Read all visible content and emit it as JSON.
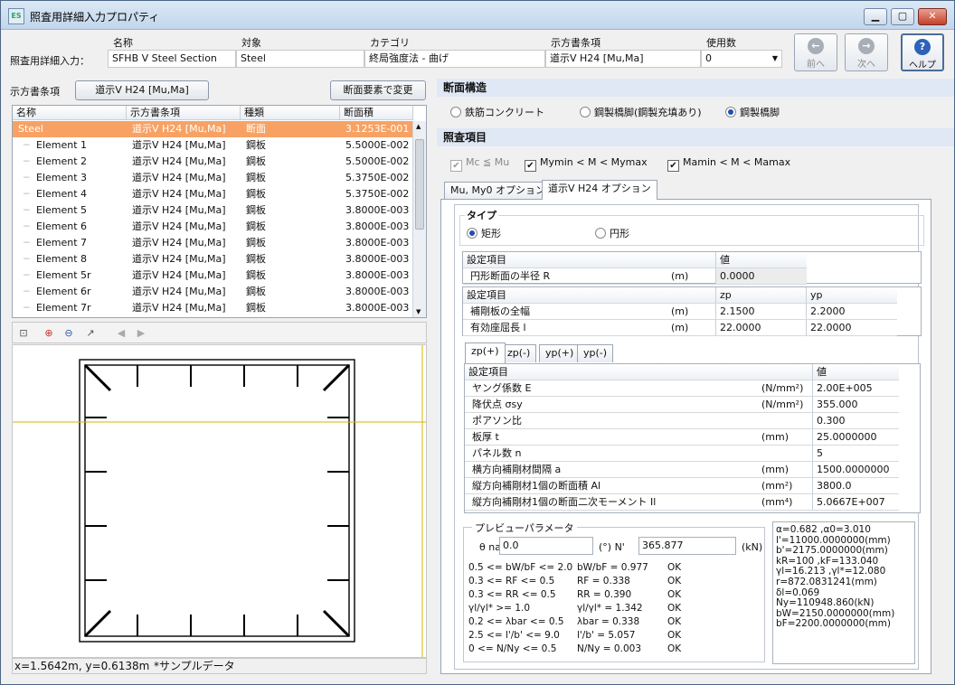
{
  "window": {
    "title": "照査用詳細入力プロパティ",
    "app_icon": "ES"
  },
  "header": {
    "row_label": "照査用詳細入力：",
    "cols": [
      "名称",
      "対象",
      "カテゴリ",
      "示方書条項",
      "使用数"
    ],
    "values": [
      "SFHB V Steel Section",
      "Steel",
      "終局強度法 - 曲げ",
      "道示V H24 [Mu,Ma]",
      "0"
    ]
  },
  "nav": {
    "prev": "前へ",
    "next": "次へ",
    "help": "ヘルプ"
  },
  "left": {
    "clause_label": "示方書条項",
    "clause_button": "道示V H24 [Mu,Ma]",
    "change_button": "断面要素で変更",
    "grid_headers": [
      "名称",
      "示方書条項",
      "種類",
      "断面積"
    ],
    "rows": [
      {
        "name": "Steel",
        "clause": "道示V H24 [Mu,Ma]",
        "kind": "断面",
        "area": "3.1253E-001"
      },
      {
        "name": "Element  1",
        "clause": "道示V H24 [Mu,Ma]",
        "kind": "鋼板",
        "area": "5.5000E-002"
      },
      {
        "name": "Element  2",
        "clause": "道示V H24 [Mu,Ma]",
        "kind": "鋼板",
        "area": "5.5000E-002"
      },
      {
        "name": "Element  3",
        "clause": "道示V H24 [Mu,Ma]",
        "kind": "鋼板",
        "area": "5.3750E-002"
      },
      {
        "name": "Element  4",
        "clause": "道示V H24 [Mu,Ma]",
        "kind": "鋼板",
        "area": "5.3750E-002"
      },
      {
        "name": "Element  5",
        "clause": "道示V H24 [Mu,Ma]",
        "kind": "鋼板",
        "area": "3.8000E-003"
      },
      {
        "name": "Element  6",
        "clause": "道示V H24 [Mu,Ma]",
        "kind": "鋼板",
        "area": "3.8000E-003"
      },
      {
        "name": "Element  7",
        "clause": "道示V H24 [Mu,Ma]",
        "kind": "鋼板",
        "area": "3.8000E-003"
      },
      {
        "name": "Element  8",
        "clause": "道示V H24 [Mu,Ma]",
        "kind": "鋼板",
        "area": "3.8000E-003"
      },
      {
        "name": "Element  5r",
        "clause": "道示V H24 [Mu,Ma]",
        "kind": "鋼板",
        "area": "3.8000E-003"
      },
      {
        "name": "Element  6r",
        "clause": "道示V H24 [Mu,Ma]",
        "kind": "鋼板",
        "area": "3.8000E-003"
      },
      {
        "name": "Element  7r",
        "clause": "道示V H24 [Mu,Ma]",
        "kind": "鋼板",
        "area": "3.8000E-003"
      }
    ],
    "status_coords": "x=1.5642m, y=0.6138m",
    "status_note": "*サンプルデータ"
  },
  "right": {
    "section_structure": "断面構造",
    "structure_options": [
      "鉄筋コンクリート",
      "鋼製橋脚(鋼製充填あり)",
      "鋼製橋脚"
    ],
    "structure_selected": 2,
    "check_items": "照査項目",
    "checks": [
      {
        "label": "Mc ≦ Mu",
        "checked": true,
        "disabled": true
      },
      {
        "label": "Mymin < M < Mymax",
        "checked": true,
        "disabled": false
      },
      {
        "label": "Mamin < M < Mamax",
        "checked": true,
        "disabled": false
      }
    ],
    "tabs": [
      "Mu, My0 オプション",
      "道示V H24 オプション"
    ],
    "type_label": "タイプ",
    "type_options": [
      "矩形",
      "円形"
    ],
    "type_selected": 0,
    "t1": {
      "h1": "設定項目",
      "h2": "値",
      "row": {
        "label": "円形断面の半径 R",
        "unit": "(m)",
        "value": "0.0000"
      }
    },
    "t2": {
      "h1": "設定項目",
      "h2": "zp",
      "h3": "yp",
      "rows": [
        {
          "label": "補剛板の全幅",
          "unit": "(m)",
          "zp": "2.1500",
          "yp": "2.2000"
        },
        {
          "label": "有効座屈長 l",
          "unit": "(m)",
          "zp": "22.0000",
          "yp": "22.0000"
        }
      ]
    },
    "subtabs": [
      "zp(+)",
      "zp(-)",
      "yp(+)",
      "yp(-)"
    ],
    "t3": {
      "h1": "設定項目",
      "h2": "値",
      "rows": [
        {
          "label": "ヤング係数 E",
          "unit": "(N/mm²)",
          "value": "2.00E+005"
        },
        {
          "label": "降伏点 σsy",
          "unit": "(N/mm²)",
          "value": "355.000"
        },
        {
          "label": "ポアソン比",
          "unit": "",
          "value": "0.300"
        },
        {
          "label": "板厚 t",
          "unit": "(mm)",
          "value": "25.0000000"
        },
        {
          "label": "パネル数 n",
          "unit": "",
          "value": "5"
        },
        {
          "label": "横方向補剛材間隔 a",
          "unit": "(mm)",
          "value": "1500.0000000"
        },
        {
          "label": "縦方向補剛材1個の断面積 Al",
          "unit": "(mm²)",
          "value": "3800.0"
        },
        {
          "label": "縦方向補剛材1個の断面二次モーメント Il",
          "unit": "(mm⁴)",
          "value": "5.0667E+007"
        }
      ]
    },
    "preview": {
      "title": "プレビューパラメータ",
      "theta_label": "θ na",
      "theta_value": "0.0",
      "theta_unit": "(°) N'",
      "n_value": "365.877",
      "n_unit": "(kN)",
      "conditions": [
        {
          "cond": "0.5 <= bW/bF <= 2.0",
          "calc": "bW/bF = 0.977",
          "res": "OK"
        },
        {
          "cond": "0.3 <= RF <= 0.5",
          "calc": "RF = 0.338",
          "res": "OK"
        },
        {
          "cond": "0.3 <= RR <= 0.5",
          "calc": "RR = 0.390",
          "res": "OK"
        },
        {
          "cond": "γl/γl* >= 1.0",
          "calc": "γl/γl* = 1.342",
          "res": "OK"
        },
        {
          "cond": "0.2 <= λbar <= 0.5",
          "calc": "λbar = 0.338",
          "res": "OK"
        },
        {
          "cond": "2.5 <= l'/b' <= 9.0",
          "calc": "l'/b' = 5.057",
          "res": "OK"
        },
        {
          "cond": "0 <= N/Ny <= 0.5",
          "calc": "N/Ny = 0.003",
          "res": "OK"
        }
      ],
      "results": [
        "α=0.682 ,α0=3.010",
        "l'=11000.0000000(mm)",
        "b'=2175.0000000(mm)",
        "kR=100 ,kF=133.040",
        "γl=16.213 ,γl*=12.080",
        "r=872.0831241(mm)",
        "δl=0.069",
        "Ny=110948.860(kN)",
        "bW=2150.0000000(mm)",
        "bF=2200.0000000(mm)"
      ]
    }
  }
}
